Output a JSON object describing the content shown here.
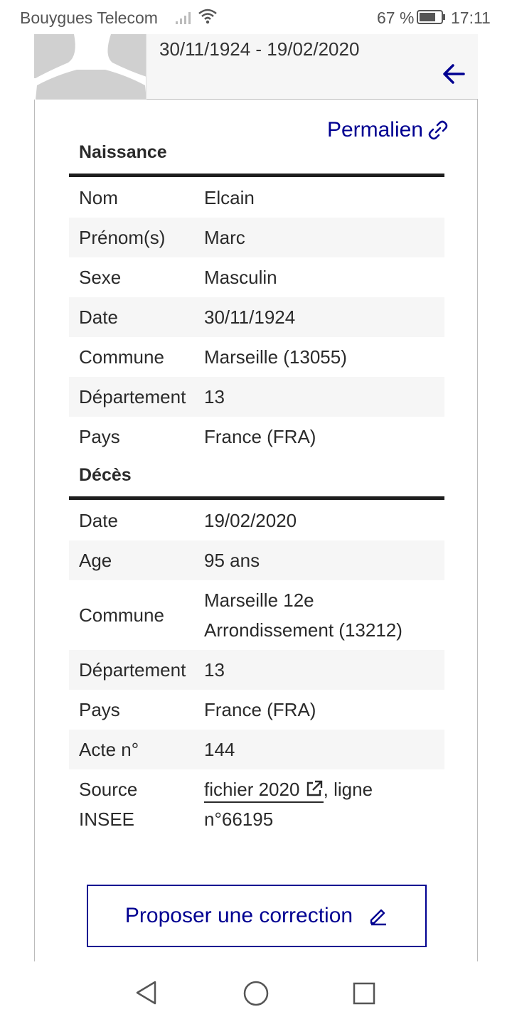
{
  "status_bar": {
    "carrier": "Bouygues Telecom",
    "battery_percent": "67 %",
    "time": "17:11"
  },
  "header": {
    "dates": "30/11/1924 - 19/02/2020"
  },
  "permalink_label": "Permalien",
  "birth": {
    "title": "Naissance",
    "rows": [
      {
        "label": "Nom",
        "value": "Elcain"
      },
      {
        "label": "Prénom(s)",
        "value": "Marc"
      },
      {
        "label": "Sexe",
        "value": "Masculin"
      },
      {
        "label": "Date",
        "value": "30/11/1924"
      },
      {
        "label": "Commune",
        "value": "Marseille (13055)"
      },
      {
        "label": "Département",
        "value": "13"
      },
      {
        "label": "Pays",
        "value": "France (FRA)"
      }
    ]
  },
  "death": {
    "title": "Décès",
    "rows": [
      {
        "label": "Date",
        "value": "19/02/2020"
      },
      {
        "label": "Age",
        "value": "95 ans"
      },
      {
        "label": "Commune",
        "value_line1": "Marseille 12e",
        "value_line2": "Arrondissement (13212)"
      },
      {
        "label": "Département",
        "value": "13"
      },
      {
        "label": "Pays",
        "value": "France (FRA)"
      },
      {
        "label": "Acte n°",
        "value": "144"
      },
      {
        "label_line1": "Source",
        "label_line2": "INSEE",
        "link_text": "fichier 2020",
        "suffix": ", ligne",
        "value_line2": "n°66195"
      }
    ]
  },
  "correction_button": "Proposer une correction",
  "colors": {
    "accent": "#000091",
    "row_alt": "#f6f6f6",
    "text": "#2a2a2a"
  },
  "icons": [
    "signal-icon",
    "wifi-icon",
    "battery-icon",
    "back-arrow-icon",
    "link-icon",
    "external-link-icon",
    "pencil-icon",
    "nav-back-icon",
    "nav-home-icon",
    "nav-recents-icon"
  ]
}
